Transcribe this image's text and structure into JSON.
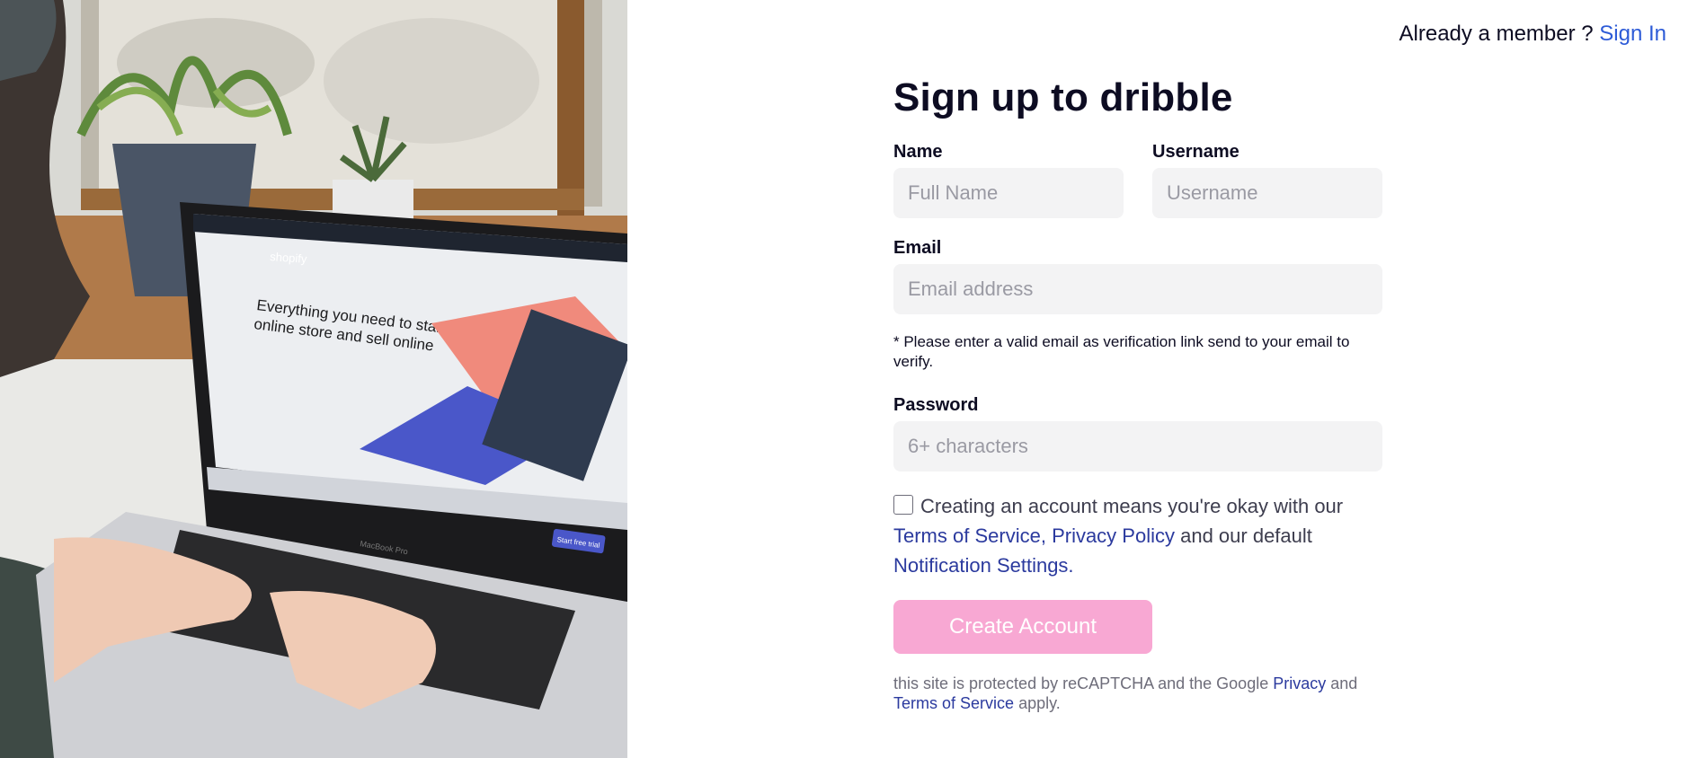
{
  "header": {
    "member_text": "Already a member ?",
    "sign_in_label": "Sign In"
  },
  "form": {
    "title": "Sign up to dribble",
    "name_label": "Name",
    "name_placeholder": "Full Name",
    "username_label": "Username",
    "username_placeholder": "Username",
    "email_label": "Email",
    "email_placeholder": "Email address",
    "email_hint": "* Please enter a valid email as verification link send to your email to verify.",
    "password_label": "Password",
    "password_placeholder": "6+ characters",
    "terms_text_1": "Creating an account means you're okay with our",
    "terms_link_1": "Terms of Service,",
    "terms_link_2": "Privacy Policy",
    "terms_text_2": "and our default",
    "terms_link_3": "Notification Settings.",
    "submit_label": "Create Account",
    "recaptcha_text_1": "this site is protected by reCAPTCHA and the Google",
    "recaptcha_link_privacy": "Privacy",
    "recaptcha_text_2": "and",
    "recaptcha_link_terms": "Terms of Service",
    "recaptcha_text_3": "apply."
  },
  "photo": {
    "screen_headline_1": "Everything you need to start an",
    "screen_headline_2": "online store and sell online",
    "screen_brand": "shopify",
    "screen_cta": "Start free trial",
    "laptop_label": "MacBook Pro"
  },
  "colors": {
    "link": "#2d5bd7",
    "terms_link": "#2b3a9e",
    "button": "#f8a8d3",
    "input_bg": "#f3f3f4"
  }
}
